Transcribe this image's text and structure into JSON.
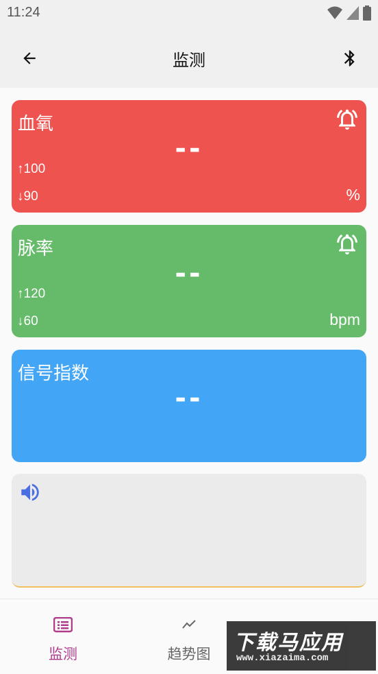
{
  "status_bar": {
    "time": "11:24"
  },
  "app_bar": {
    "title": "监测"
  },
  "cards": {
    "spo2": {
      "title": "血氧",
      "value": "--",
      "upper_limit": "↑100",
      "lower_limit": "↓90",
      "unit": "%",
      "color": "#ef5350"
    },
    "pulse": {
      "title": "脉率",
      "value": "--",
      "upper_limit": "↑120",
      "lower_limit": "↓60",
      "unit": "bpm",
      "color": "#66bb6a"
    },
    "signal": {
      "title": "信号指数",
      "value": "--",
      "color": "#42a5f5"
    }
  },
  "bottom_nav": {
    "items": [
      {
        "label": "监测",
        "icon": "monitor-list-icon",
        "active": true,
        "color": "#b03a8c"
      },
      {
        "label": "趋势图",
        "icon": "trend-chart-icon",
        "active": false,
        "color": "#666666"
      }
    ]
  },
  "watermark": {
    "title": "下载马应用",
    "url": "www.xiazaima.com"
  }
}
